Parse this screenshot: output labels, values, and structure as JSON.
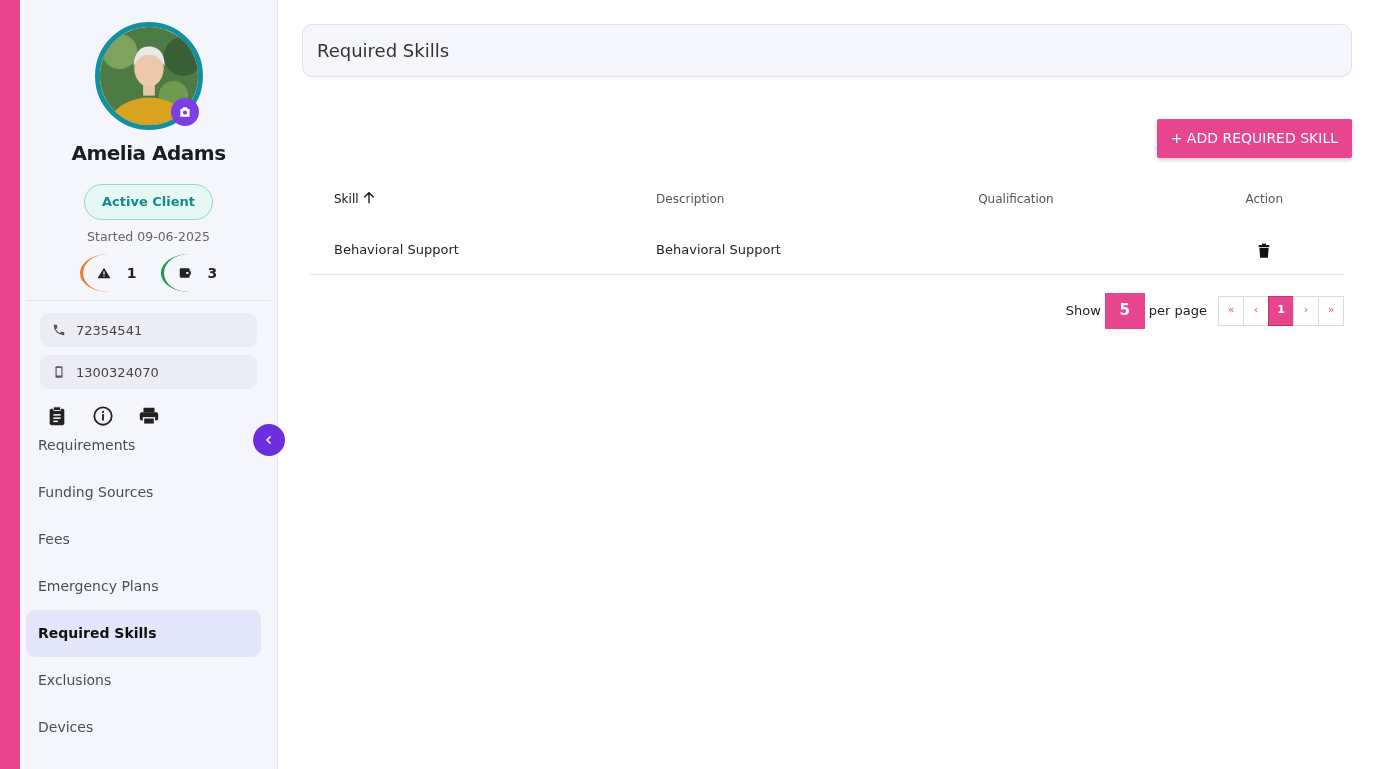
{
  "client": {
    "name": "Amelia Adams",
    "status": "Active Client",
    "started": "Started 09-06-2025",
    "alerts": "1",
    "wallets": "3",
    "phone": "72354541",
    "mobile": "1300324070"
  },
  "nav": [
    {
      "label": "Requirements",
      "selected": false
    },
    {
      "label": "Funding Sources",
      "selected": false
    },
    {
      "label": "Fees",
      "selected": false
    },
    {
      "label": "Emergency Plans",
      "selected": false
    },
    {
      "label": "Required Skills",
      "selected": true
    },
    {
      "label": "Exclusions",
      "selected": false
    },
    {
      "label": "Devices",
      "selected": false
    }
  ],
  "page": {
    "title": "Required Skills",
    "add_button": "+ ADD REQUIRED SKILL"
  },
  "table": {
    "columns": [
      {
        "label": "Skill",
        "sorted": true
      },
      {
        "label": "Description",
        "sorted": false
      },
      {
        "label": "Qualification",
        "sorted": false
      },
      {
        "label": "Action",
        "sorted": false
      }
    ],
    "rows": [
      {
        "skill": "Behavioral Support",
        "description": "Behavioral Support"
      }
    ]
  },
  "pagination": {
    "show": "Show",
    "page_size": "5",
    "per_page": "per page",
    "pages": [
      {
        "label": "«",
        "selected": false
      },
      {
        "label": "‹",
        "selected": false
      },
      {
        "label": "1",
        "selected": true
      },
      {
        "label": "›",
        "selected": false
      },
      {
        "label": "»",
        "selected": false
      }
    ]
  }
}
